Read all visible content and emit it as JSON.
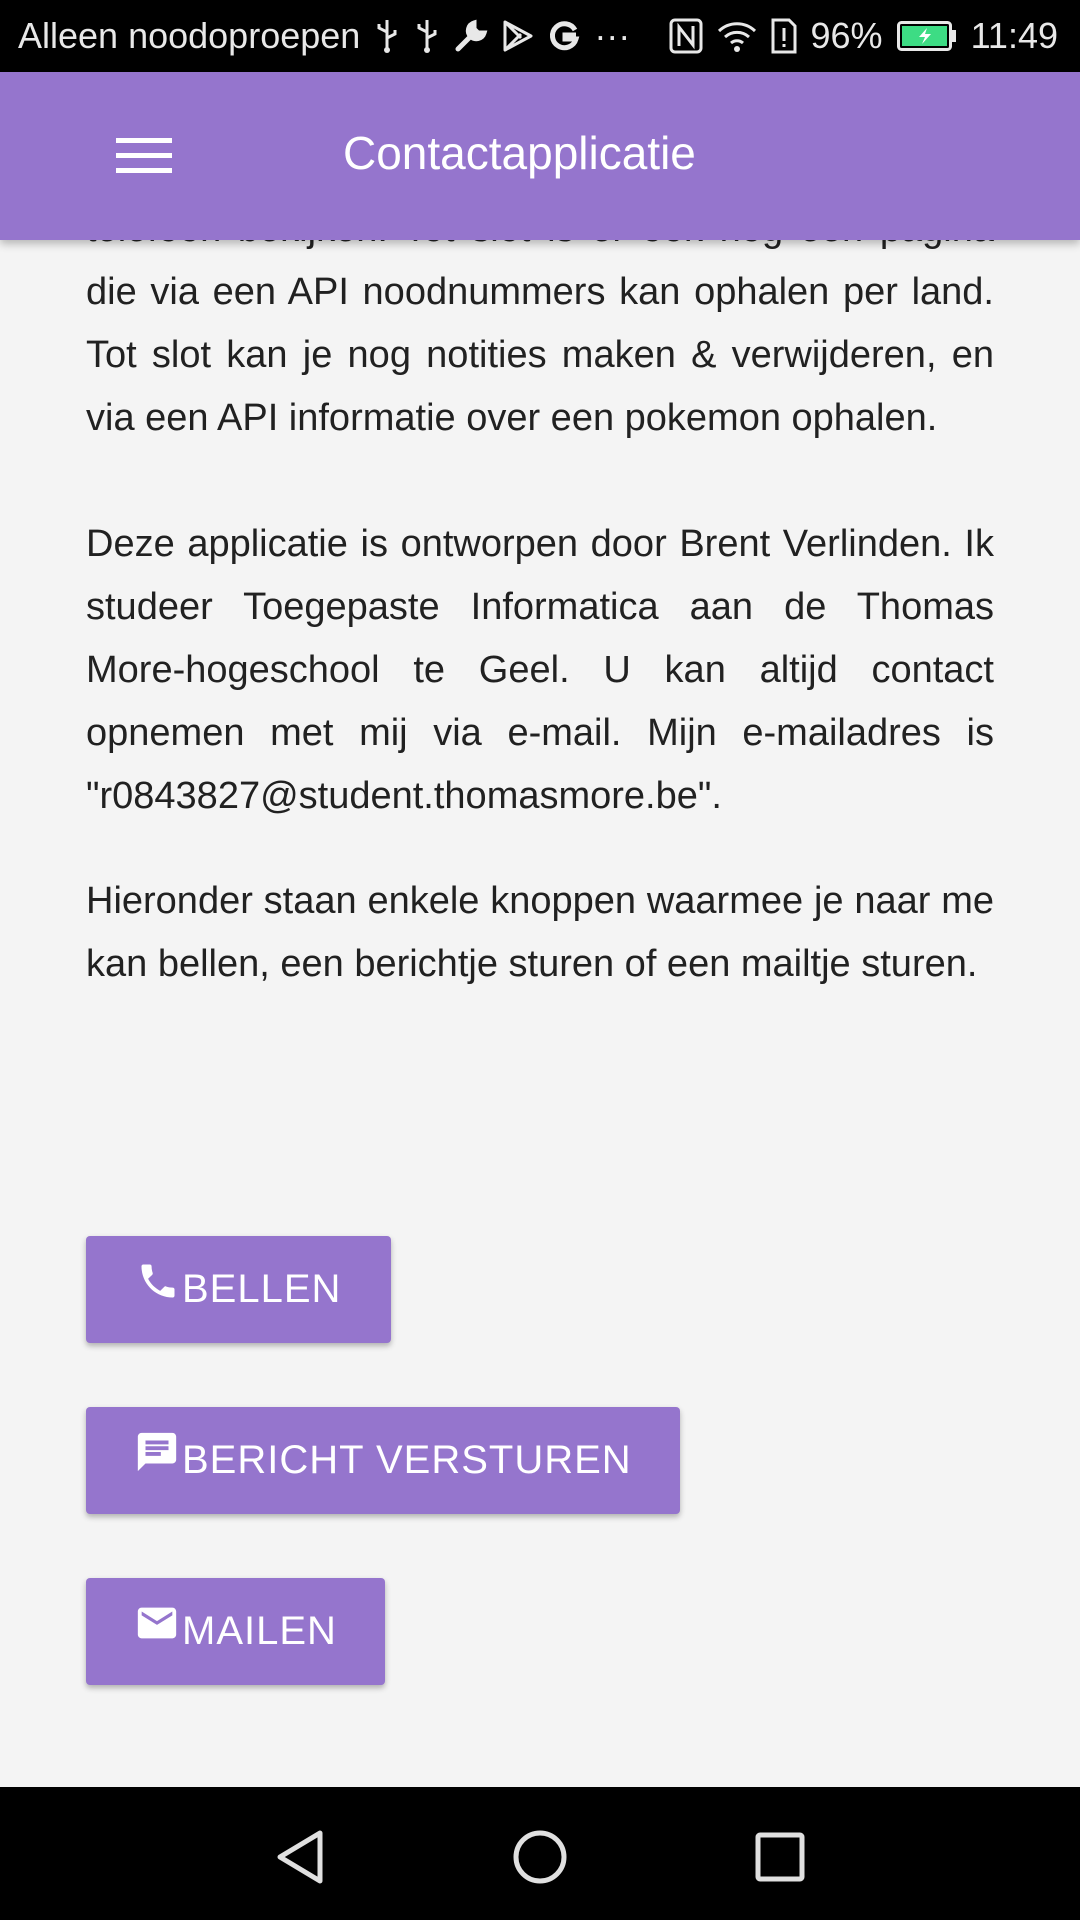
{
  "status_bar": {
    "carrier": "Alleen noodoproepen",
    "more": "···",
    "battery_percent": "96%",
    "time": "11:49",
    "icons": [
      "usb-icon",
      "usb-icon",
      "wrench-icon",
      "play-store-icon",
      "google-icon",
      "nfc-icon",
      "wifi-icon",
      "sim-alert-icon",
      "battery-charging-icon"
    ],
    "battery_color": "#3ddc84"
  },
  "app_bar": {
    "menu_icon": "hamburger-menu-icon",
    "title": "Contactapplicatie",
    "color": "#9575cd"
  },
  "content": {
    "para1_partial_top": "telefoon bekijken. Tot slot is er ook nog een",
    "para1_rest": "pagina die via een API noodnummers kan ophalen per land. Tot slot kan je nog notities maken & verwijderen, en via een API informatie over een pokemon ophalen.",
    "para2": "Deze applicatie is ontworpen door Brent Verlinden. Ik studeer Toegepaste Informatica aan de Thomas More-hogeschool te Geel. U kan altijd contact opnemen met mij via e-mail. Mijn e-mailadres is \"r0843827@student.thomasmore.be\".",
    "para3": "Hieronder staan enkele knoppen waarmee je naar me kan bellen, een berichtje sturen of een mailtje sturen."
  },
  "buttons": {
    "call": {
      "label": "BELLEN",
      "icon": "phone-icon"
    },
    "message": {
      "label": "BERICHT VERSTUREN",
      "icon": "message-icon"
    },
    "mail": {
      "label": "MAILEN",
      "icon": "mail-icon"
    }
  },
  "nav_bar": {
    "icons": [
      "back-icon",
      "home-icon",
      "recents-icon"
    ]
  }
}
